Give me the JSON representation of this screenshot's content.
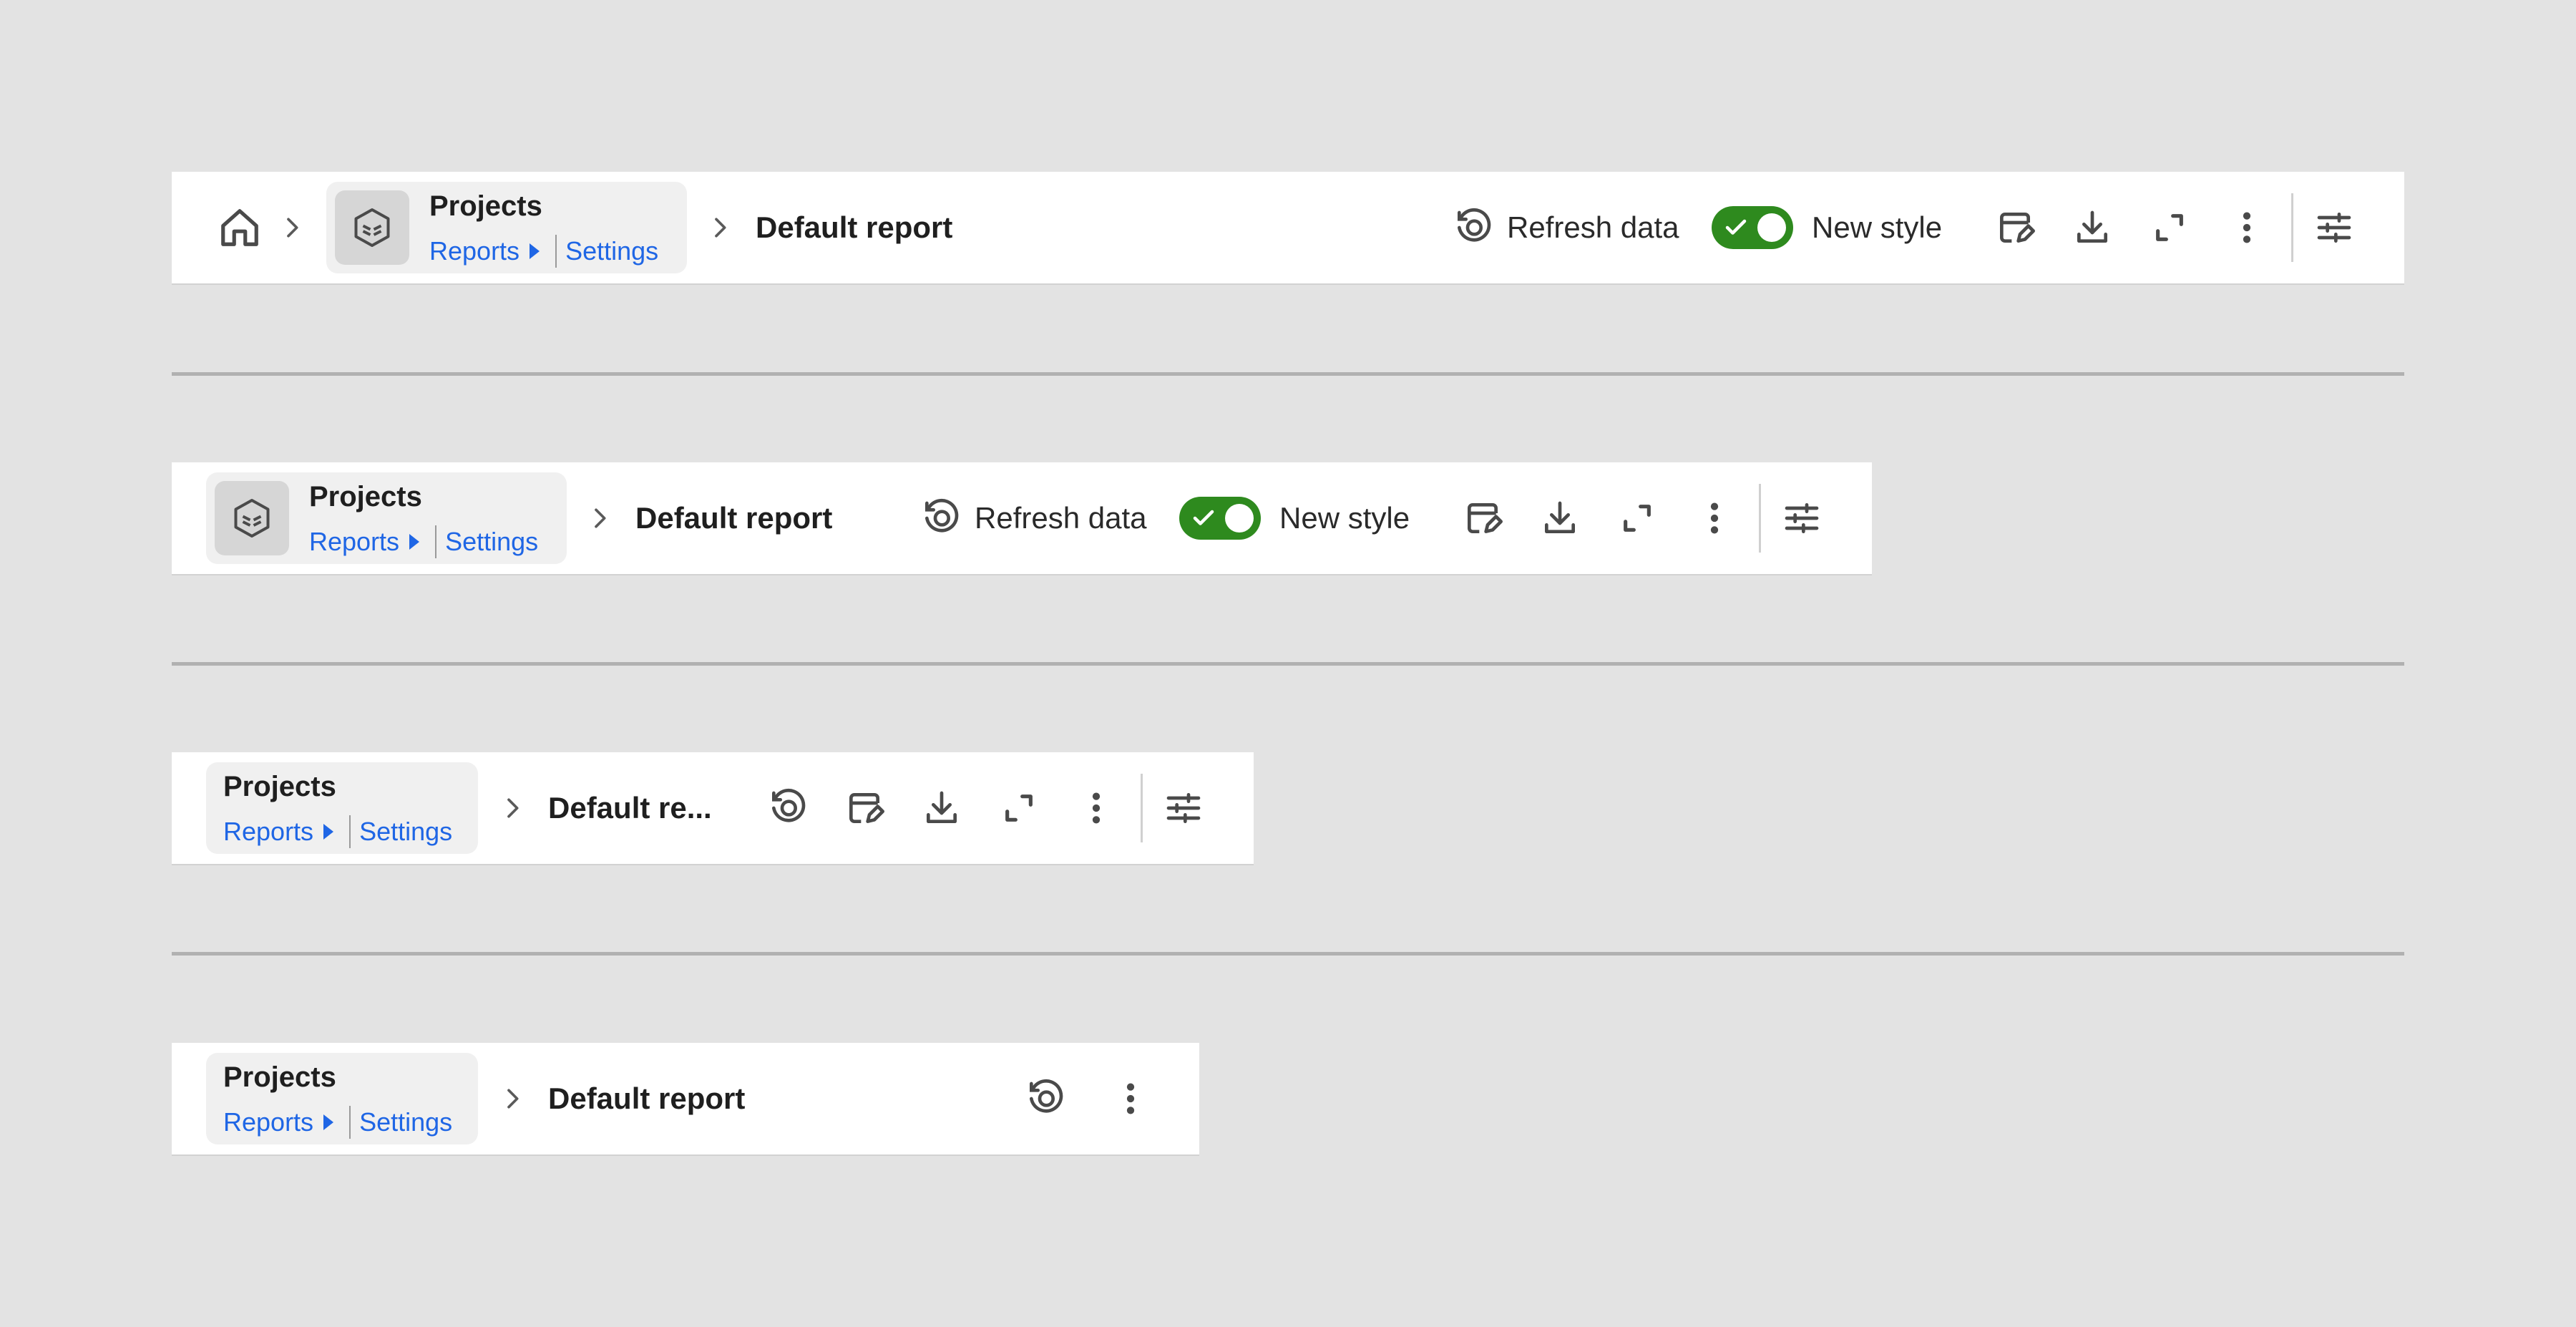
{
  "variants": [
    {
      "breadcrumb": {
        "title": "Projects",
        "links": [
          "Reports",
          "Settings"
        ]
      },
      "page_title": "Default report",
      "actions": {
        "refresh_label": "Refresh data",
        "toggle_label": "New style",
        "toggle_on": true
      }
    },
    {
      "breadcrumb": {
        "title": "Projects",
        "links": [
          "Reports",
          "Settings"
        ]
      },
      "page_title": "Default report",
      "actions": {
        "refresh_label": "Refresh data",
        "toggle_label": "New style",
        "toggle_on": true
      }
    },
    {
      "breadcrumb": {
        "title": "Projects",
        "links": [
          "Reports",
          "Settings"
        ]
      },
      "page_title": "Default re..."
    },
    {
      "breadcrumb": {
        "title": "Projects",
        "links": [
          "Reports",
          "Settings"
        ]
      },
      "page_title": "Default report"
    }
  ],
  "icons": {
    "home": "home-icon",
    "chevron": "chevron-right-icon",
    "logo": "cube-icon",
    "refresh": "refresh-icon",
    "edit": "edit-report-icon",
    "download": "download-icon",
    "expand": "expand-icon",
    "more": "more-vertical-icon",
    "settings": "sliders-icon"
  },
  "colors": {
    "accent": "#1f66e5",
    "toggle": "#2e8a1e",
    "background": "#e3e3e3"
  }
}
